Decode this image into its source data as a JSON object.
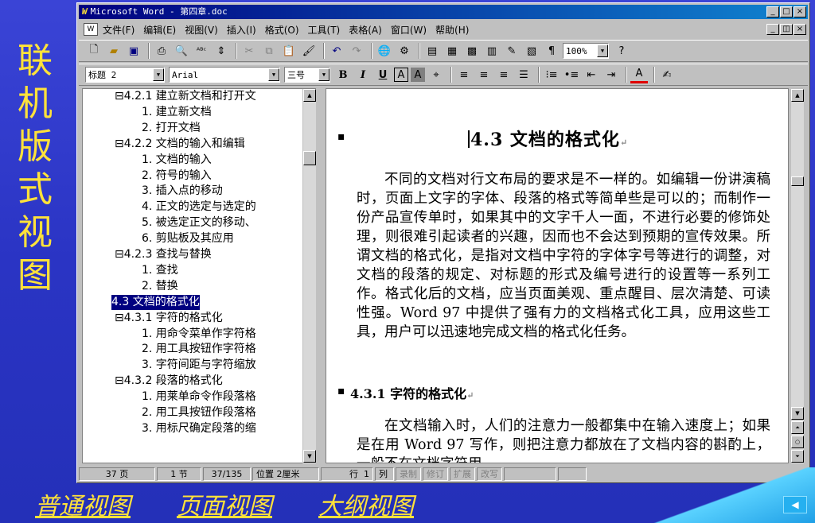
{
  "slide": {
    "side_title": [
      "联",
      "机",
      "版",
      "式",
      "视",
      "图"
    ],
    "links": [
      "普通视图",
      "页面视图",
      "大纲视图"
    ]
  },
  "window": {
    "title": "Microsoft Word - 第四章.doc",
    "menu": [
      "文件(F)",
      "编辑(E)",
      "视图(V)",
      "插入(I)",
      "格式(O)",
      "工具(T)",
      "表格(A)",
      "窗口(W)",
      "帮助(H)"
    ],
    "toolbar": {
      "zoom": "100%",
      "style": "标题 2",
      "font": "Arial",
      "size": "三号"
    }
  },
  "outline": [
    {
      "indent": 2,
      "text": "⊟4.2.1  建立新文档和打开文"
    },
    {
      "indent": 3,
      "text": "1. 建立新文档"
    },
    {
      "indent": 3,
      "text": "2. 打开文档"
    },
    {
      "indent": 2,
      "text": "⊟4.2.2  文档的输入和编辑"
    },
    {
      "indent": 3,
      "text": "1. 文档的输入"
    },
    {
      "indent": 3,
      "text": "2. 符号的输入"
    },
    {
      "indent": 3,
      "text": "3. 插入点的移动"
    },
    {
      "indent": 3,
      "text": "4. 正文的选定与选定的"
    },
    {
      "indent": 3,
      "text": "5. 被选定正文的移动、"
    },
    {
      "indent": 3,
      "text": "6. 剪贴板及其应用"
    },
    {
      "indent": 2,
      "text": "⊟4.2.3  查找与替换"
    },
    {
      "indent": 3,
      "text": "1. 查找"
    },
    {
      "indent": 3,
      "text": "2. 替换"
    },
    {
      "indent": 1,
      "text": "4.3 文档的格式化",
      "selected": true
    },
    {
      "indent": 2,
      "text": "⊟4.3.1  字符的格式化"
    },
    {
      "indent": 3,
      "text": "1. 用命令菜单作字符格"
    },
    {
      "indent": 3,
      "text": "2. 用工具按钮作字符格"
    },
    {
      "indent": 3,
      "text": "3. 字符间距与字符缩放"
    },
    {
      "indent": 2,
      "text": "⊟4.3.2  段落的格式化"
    },
    {
      "indent": 3,
      "text": "1. 用莱单命令作段落格"
    },
    {
      "indent": 3,
      "text": "2. 用工具按钮作段落格"
    },
    {
      "indent": 3,
      "text": "3. 用标尺确定段落的缩"
    }
  ],
  "document": {
    "heading": "4.3  文档的格式化",
    "para1": "不同的文档对行文布局的要求是不一样的。如编辑一份讲演稿时，页面上文字的字体、段落的格式等简单些是可以的；而制作一份产品宣传单时，如果其中的文字千人一面，不进行必要的修饰处理，则很难引起读者的兴趣，因而也不会达到预期的宣传效果。所谓文档的格式化，是指对文档中字符的字体字号等进行的调整，对文档的段落的规定、对标题的形式及编号进行的设置等一系列工作。格式化后的文档，应当页面美观、重点醒目、层次清楚、可读性强。Word 97 中提供了强有力的文档格式化工具，应用这些工具，用户可以迅速地完成文档的格式化任务。",
    "subheading": "4.3.1  字符的格式化",
    "para2": "在文档输入时，人们的注意力一般都集中在输入速度上；如果是在用 Word 97 写作，则把注意力都放在了文档内容的斟酌上，一般不在文档字符用"
  },
  "status": {
    "page": "37 页",
    "section": "1 节",
    "pages": "37/135",
    "position": "位置 2厘米",
    "line": "行  1",
    "col": "列",
    "rec": "录制",
    "trk": "修订",
    "ext": "扩展",
    "ovr": "改写"
  }
}
